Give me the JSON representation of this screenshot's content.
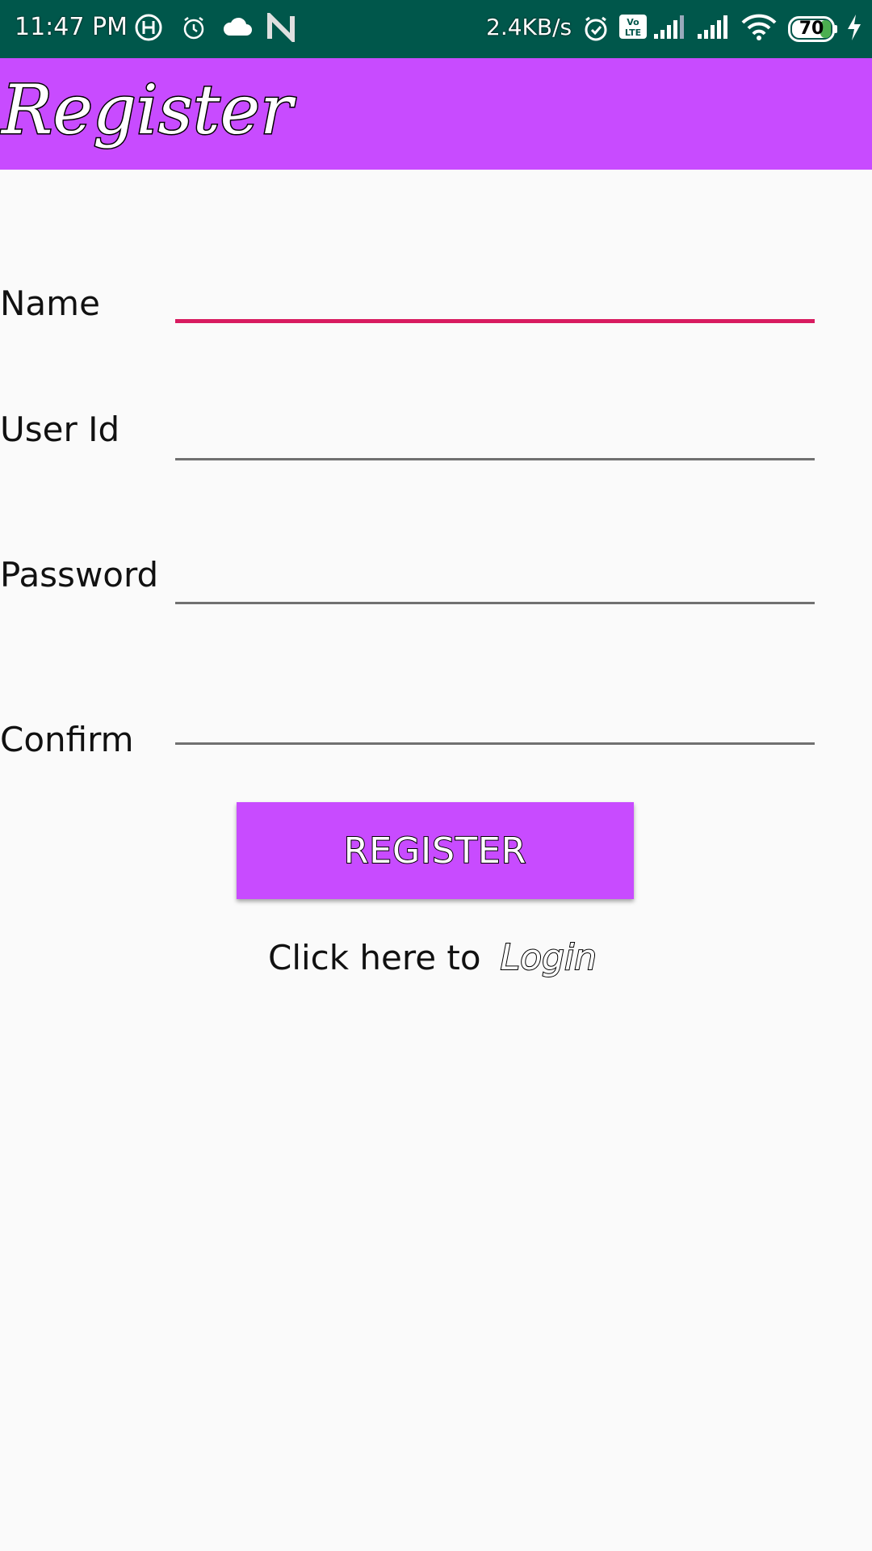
{
  "status_bar": {
    "time": "11:47 PM",
    "network_speed": "2.4KB/s",
    "battery_level": "70",
    "icons": [
      "h-badge-icon",
      "alarm-icon",
      "cloud-icon",
      "n-logo-icon",
      "alarm-icon",
      "volte-icon",
      "signal-icon",
      "signal-icon",
      "wifi-icon",
      "battery-icon",
      "charging-icon"
    ]
  },
  "app_bar": {
    "title": "Register",
    "color": "#c84bff"
  },
  "form": {
    "fields": [
      {
        "label": "Name",
        "value": "",
        "active": true
      },
      {
        "label": "User Id",
        "value": ""
      },
      {
        "label": "Password",
        "value": ""
      },
      {
        "label": "Confirm",
        "value": ""
      }
    ],
    "accent_color": "#d81b60"
  },
  "register_button": {
    "label": "REGISTER"
  },
  "login": {
    "prompt": "Click here to",
    "link": "Login"
  }
}
